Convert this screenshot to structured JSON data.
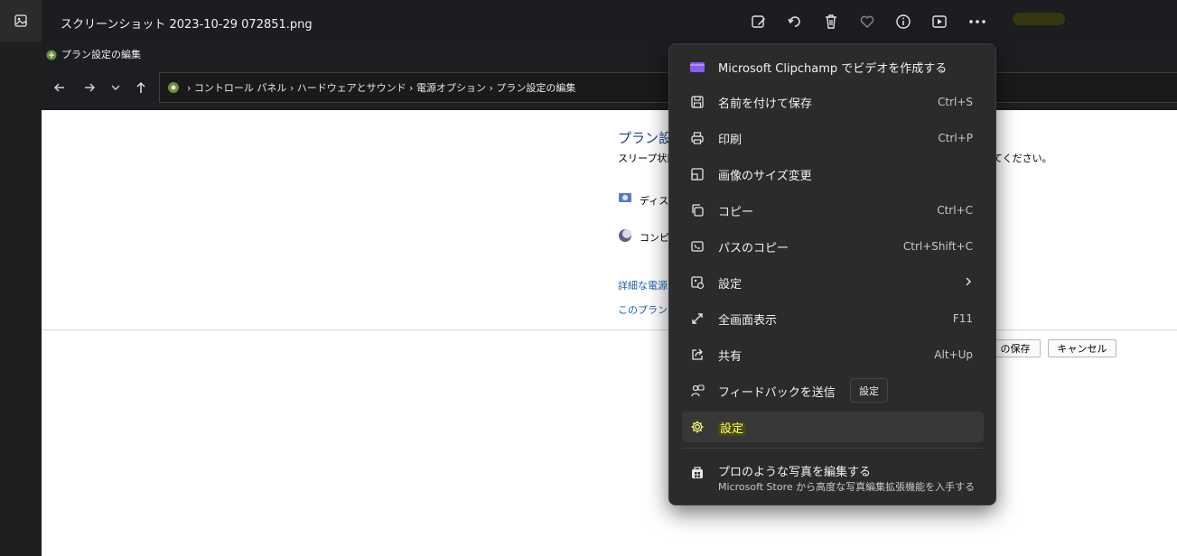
{
  "window": {
    "title": "スクリーンショット 2023-10-29 072851.png"
  },
  "toolbar_icons": [
    "edit-image-icon",
    "rotate-icon",
    "delete-icon",
    "favorite-icon",
    "info-icon",
    "slideshow-icon",
    "more-options-icon"
  ],
  "control_panel": {
    "title": "プラン設定の編集",
    "address": "›  コントロール パネル  ›  ハードウェアとサウンド  ›  電源オプション  ›  プラン設定の編集",
    "heading": "プラン設定",
    "description_start": "スリープ状態",
    "description_end": "てください。",
    "rows": [
      {
        "label": "ディスプ",
        "icon": "display-icon"
      },
      {
        "label": "コンピュ",
        "icon": "moon-icon"
      }
    ],
    "links": [
      "詳細な電源",
      "このプランの既"
    ],
    "save_button": "の保存",
    "cancel_button": "キャンセル"
  },
  "menu": {
    "items": [
      {
        "label": "Microsoft Clipchamp でビデオを作成する",
        "shortcut": "",
        "icon": "clipchamp-icon"
      },
      {
        "label": "名前を付けて保存",
        "shortcut": "Ctrl+S",
        "icon": "save-icon"
      },
      {
        "label": "印刷",
        "shortcut": "Ctrl+P",
        "icon": "print-icon"
      },
      {
        "label": "画像のサイズ変更",
        "shortcut": "",
        "icon": "resize-icon"
      },
      {
        "label": "コピー",
        "shortcut": "Ctrl+C",
        "icon": "copy-icon"
      },
      {
        "label": "パスのコピー",
        "shortcut": "Ctrl+Shift+C",
        "icon": "copy-path-icon"
      },
      {
        "label": "設定",
        "shortcut": "",
        "icon": "set-as-icon",
        "submenu": true
      },
      {
        "label": "全画面表示",
        "shortcut": "F11",
        "icon": "fullscreen-icon"
      },
      {
        "label": "共有",
        "shortcut": "Alt+Up",
        "icon": "share-icon"
      },
      {
        "label": "フィードバックを送信",
        "shortcut": "",
        "icon": "feedback-icon"
      },
      {
        "label": "設定",
        "shortcut": "",
        "icon": "settings-gear-icon",
        "hover": true
      }
    ],
    "pro": {
      "title": "プロのような写真を編集する",
      "subtitle": "Microsoft Store から高度な写真編集拡張機能を入手する"
    }
  },
  "tooltip": {
    "text": "設定"
  },
  "colors": {
    "menu_bg": "#2b2b2b",
    "highlight": "#ffff7a",
    "link": "#1e5fb5",
    "heading": "#1e3f8c"
  }
}
